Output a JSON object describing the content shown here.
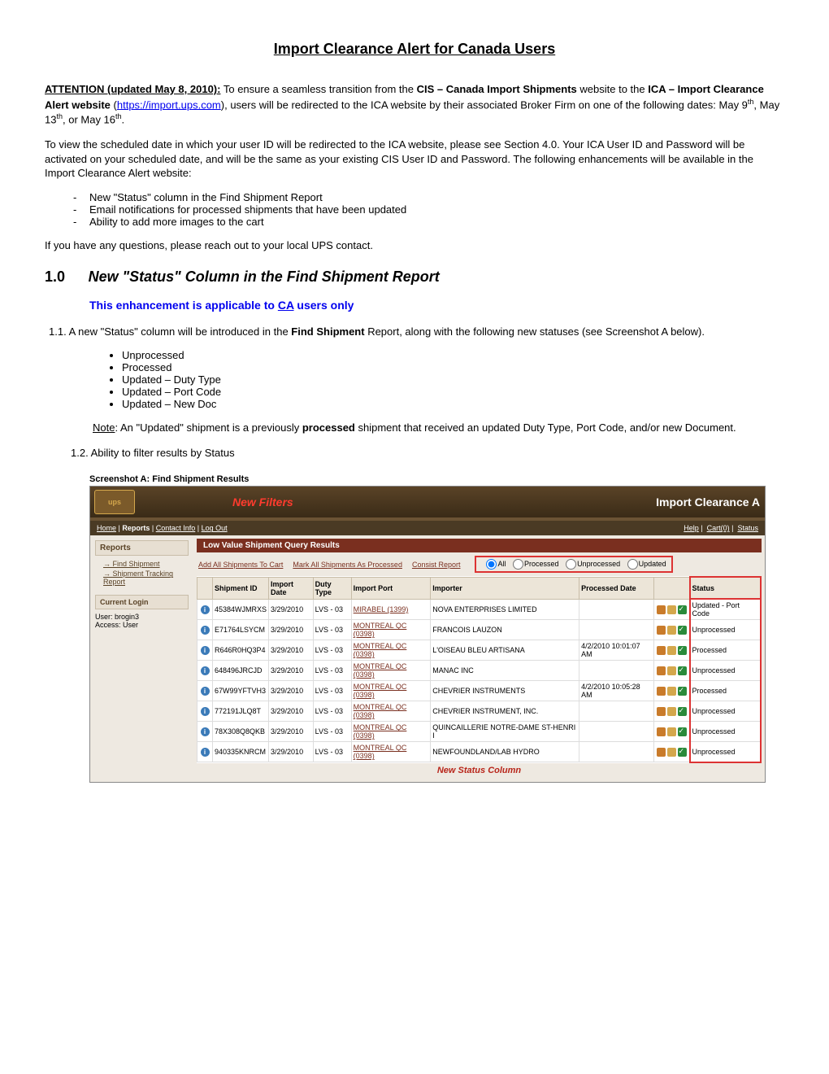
{
  "title": "Import Clearance Alert for Canada Users",
  "attn": {
    "lead": "ATTENTION (updated May 8, 2010):",
    "t1": " To ensure a seamless transition from the ",
    "b1": "CIS – Canada Import Shipments",
    "t2": " website to the ",
    "b2": "ICA – Import Clearance Alert website",
    "t3": " (",
    "link": "https://import.ups.com",
    "t4": "), users will be redirected to the ICA website by their associated Broker Firm on one of the following dates: May 9",
    "t5": ", May 13",
    "t6": ", or May 16",
    "t7": "."
  },
  "p2": "To view the scheduled date in which your user ID will be redirected to the ICA website, please see Section 4.0.  Your ICA User ID and Password will be activated on your scheduled date, and will be the same as your existing CIS User ID and Password.  The following enhancements will be available in the Import Clearance Alert website:",
  "enh": [
    "New \"Status\" column in the Find Shipment Report",
    "Email notifications for processed shipments that have been updated",
    "Ability to add more images to the cart"
  ],
  "p3": "If you have any questions, please reach out to your local UPS contact.",
  "sec": {
    "num": "1.0",
    "title": "New \"Status\" Column in the Find Shipment Report",
    "sub_pre": "This enhancement is applicable to ",
    "sub_link": "CA",
    "sub_post": " users only"
  },
  "p11_pre": "1.1.  A new \"Status\" column will be introduced in the ",
  "p11_b": "Find Shipment",
  "p11_post": " Report, along with the following new statuses (see Screenshot A below).",
  "statuses": [
    "Unprocessed",
    "Processed",
    "Updated – Duty Type",
    "Updated – Port Code",
    "Updated – New Doc"
  ],
  "note": {
    "l": "Note",
    "t1": ": An \"Updated\" shipment is a previously ",
    "b": "processed",
    "t2": " shipment that received an updated Duty Type, Port Code, and/or new Document."
  },
  "p12": "1.2.  Ability to filter results by Status",
  "caption": "Screenshot A:  Find Shipment Results",
  "shot": {
    "logo": "ups",
    "nf": "New Filters",
    "ica": "Import Clearance A",
    "nav": {
      "home": "Home",
      "reports": "Reports",
      "contact": "Contact Info",
      "logout": "Log Out",
      "help": "Help",
      "cart": "Cart(0)",
      "status": "Status"
    },
    "side": {
      "h": "Reports",
      "l1": "Find Shipment",
      "l2": "Shipment Tracking Report",
      "cur": "Current Login",
      "u": "User: brogin3",
      "a": "Access: User"
    },
    "qh": "Low Value Shipment Query Results",
    "acts": {
      "a1": "Add All Shipments To Cart",
      "a2": "Mark All Shipments As Processed",
      "a3": "Consist Report"
    },
    "filters": {
      "all": "All",
      "p": "Processed",
      "u": "Unprocessed",
      "upd": "Updated"
    },
    "cols": {
      "sid": "Shipment ID",
      "idate": "Import Date",
      "dtype": "Duty Type",
      "port": "Import Port",
      "imp": "Importer",
      "pdate": "Processed Date",
      "status": "Status"
    },
    "rows": [
      {
        "sid": "45384WJMRXS",
        "idate": "3/29/2010",
        "dtype": "LVS - 03",
        "port": "MIRABEL (1399)",
        "imp": "NOVA ENTERPRISES LIMITED",
        "pdate": "",
        "status": "Updated - Port Code"
      },
      {
        "sid": "E71764LSYCM",
        "idate": "3/29/2010",
        "dtype": "LVS - 03",
        "port": "MONTREAL QC (0398)",
        "imp": "FRANCOIS LAUZON",
        "pdate": "",
        "status": "Unprocessed"
      },
      {
        "sid": "R646R0HQ3P4",
        "idate": "3/29/2010",
        "dtype": "LVS - 03",
        "port": "MONTREAL QC (0398)",
        "imp": "L'OISEAU BLEU ARTISANA",
        "pdate": "4/2/2010 10:01:07 AM",
        "status": "Processed"
      },
      {
        "sid": "648496JRCJD",
        "idate": "3/29/2010",
        "dtype": "LVS - 03",
        "port": "MONTREAL QC (0398)",
        "imp": "MANAC INC",
        "pdate": "",
        "status": "Unprocessed"
      },
      {
        "sid": "67W99YFTVH3",
        "idate": "3/29/2010",
        "dtype": "LVS - 03",
        "port": "MONTREAL QC (0398)",
        "imp": "CHEVRIER INSTRUMENTS",
        "pdate": "4/2/2010 10:05:28 AM",
        "status": "Processed"
      },
      {
        "sid": "772191JLQ8T",
        "idate": "3/29/2010",
        "dtype": "LVS - 03",
        "port": "MONTREAL QC (0398)",
        "imp": "CHEVRIER INSTRUMENT, INC.",
        "pdate": "",
        "status": "Unprocessed"
      },
      {
        "sid": "78X308Q8QKB",
        "idate": "3/29/2010",
        "dtype": "LVS - 03",
        "port": "MONTREAL QC (0398)",
        "imp": "QUINCAILLERIE NOTRE-DAME ST-HENRI I",
        "pdate": "",
        "status": "Unprocessed"
      },
      {
        "sid": "940335KNRCM",
        "idate": "3/29/2010",
        "dtype": "LVS - 03",
        "port": "MONTREAL QC (0398)",
        "imp": "NEWFOUNDLAND/LAB HYDRO",
        "pdate": "",
        "status": "Unprocessed"
      }
    ],
    "callout": "New Status Column"
  }
}
